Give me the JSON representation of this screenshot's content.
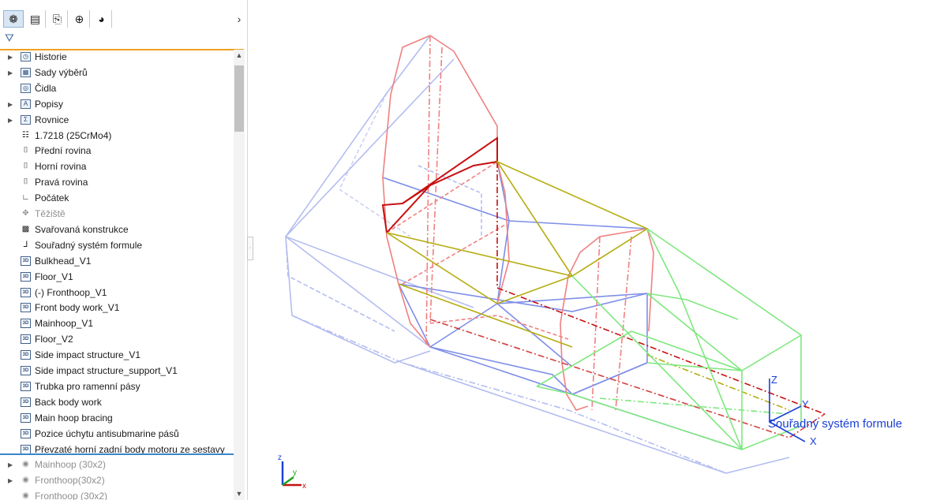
{
  "tabs": [
    {
      "name": "feature-manager-icon",
      "glyph": "❁"
    },
    {
      "name": "property-manager-icon",
      "glyph": "▤"
    },
    {
      "name": "configuration-manager-icon",
      "glyph": "⎘"
    },
    {
      "name": "dimxpert-icon",
      "glyph": "⊕"
    },
    {
      "name": "display-manager-icon",
      "glyph": "◕"
    }
  ],
  "tabs_more": "›",
  "filter_glyph": "⛛",
  "tree": [
    {
      "label": "Historie",
      "icon": "history-icon",
      "glyph": "◷",
      "style": "box",
      "expand": true
    },
    {
      "label": "Sady výběrů",
      "icon": "selection-sets-icon",
      "glyph": "▦",
      "style": "box",
      "expand": true
    },
    {
      "label": "Čidla",
      "icon": "sensor-icon",
      "glyph": "◎",
      "style": "box",
      "expand": false
    },
    {
      "label": "Popisy",
      "icon": "annotations-icon",
      "glyph": "A",
      "style": "box",
      "expand": true
    },
    {
      "label": "Rovnice",
      "icon": "equations-icon",
      "glyph": "Σ",
      "style": "box",
      "expand": true
    },
    {
      "label": "1.7218 (25CrMo4)",
      "icon": "material-icon",
      "glyph": "☷",
      "style": "plain",
      "expand": false
    },
    {
      "label": "Přední rovina",
      "icon": "plane-icon",
      "glyph": "⌷",
      "style": "plain",
      "expand": false
    },
    {
      "label": "Horní rovina",
      "icon": "plane-icon",
      "glyph": "⌷",
      "style": "plain",
      "expand": false
    },
    {
      "label": "Pravá rovina",
      "icon": "plane-icon",
      "glyph": "⌷",
      "style": "plain",
      "expand": false
    },
    {
      "label": "Počátek",
      "icon": "origin-icon",
      "glyph": "∟",
      "style": "plain",
      "expand": false
    },
    {
      "label": "Těžiště",
      "icon": "center-of-mass-icon",
      "glyph": "✥",
      "style": "plain",
      "expand": false,
      "dim": true
    },
    {
      "label": "Svařovaná konstrukce",
      "icon": "weldment-icon",
      "glyph": "▩",
      "style": "plain",
      "expand": false
    },
    {
      "label": "Souřadný systém formule",
      "icon": "coordinate-system-icon",
      "glyph": "⅃",
      "style": "plain",
      "expand": false
    },
    {
      "label": "Bulkhead_V1",
      "icon": "3d-sketch-icon",
      "glyph": "3D",
      "style": "sd",
      "expand": false
    },
    {
      "label": "Floor_V1",
      "icon": "3d-sketch-icon",
      "glyph": "3D",
      "style": "sd",
      "expand": false
    },
    {
      "label": "(-) Fronthoop_V1",
      "icon": "3d-sketch-icon",
      "glyph": "3D",
      "style": "sd",
      "expand": false
    },
    {
      "label": "Front body work_V1",
      "icon": "3d-sketch-icon",
      "glyph": "3D",
      "style": "sd",
      "expand": false
    },
    {
      "label": "Mainhoop_V1",
      "icon": "3d-sketch-icon",
      "glyph": "3D",
      "style": "sd",
      "expand": false
    },
    {
      "label": "Floor_V2",
      "icon": "3d-sketch-icon",
      "glyph": "3D",
      "style": "sd",
      "expand": false
    },
    {
      "label": "Side impact structure_V1",
      "icon": "3d-sketch-icon",
      "glyph": "3D",
      "style": "sd",
      "expand": false
    },
    {
      "label": "Side impact structure_support_V1",
      "icon": "3d-sketch-icon",
      "glyph": "3D",
      "style": "sd",
      "expand": false
    },
    {
      "label": "Trubka pro ramenní pásy",
      "icon": "3d-sketch-icon",
      "glyph": "3D",
      "style": "sd",
      "expand": false
    },
    {
      "label": "Back body work",
      "icon": "3d-sketch-icon",
      "glyph": "3D",
      "style": "sd",
      "expand": false
    },
    {
      "label": "Main hoop bracing",
      "icon": "3d-sketch-icon",
      "glyph": "3D",
      "style": "sd",
      "expand": false
    },
    {
      "label": "Pozice úchytu antisubmarine pásů",
      "icon": "3d-sketch-icon",
      "glyph": "3D",
      "style": "sd",
      "expand": false
    },
    {
      "label": "Převzaté horní zadní body motoru ze sestavy",
      "icon": "3d-sketch-icon",
      "glyph": "3D",
      "style": "sd",
      "expand": false
    },
    {
      "label": "Mainhoop (30x2)",
      "icon": "structural-member-icon",
      "glyph": "◉",
      "style": "plain",
      "expand": true,
      "dim": true
    },
    {
      "label": "Fronthoop(30x2)",
      "icon": "structural-member-icon",
      "glyph": "◉",
      "style": "plain",
      "expand": true,
      "dim": true
    },
    {
      "label": "Fronthoop (30x2)",
      "icon": "structural-member-icon",
      "glyph": "◉",
      "style": "plain",
      "expand": false,
      "dim": true
    }
  ],
  "viewport": {
    "csys_label": "Souřadný systém formule",
    "triad_labels": {
      "x": "X",
      "y": "Y",
      "z": "Z"
    },
    "mini_triad_labels": {
      "x": "x",
      "y": "y",
      "z": "z"
    }
  },
  "colors": {
    "panel_accent": "#f0a11e",
    "separator": "#3a86c8",
    "hoop": "#f08080",
    "bulkhead": "#c81010",
    "side_impact": "#b5ad10",
    "floor": "#7e8ee8",
    "front_body": "#b4bdf0",
    "back_body": "#7ee87e",
    "csys": "#1a3fd6"
  }
}
